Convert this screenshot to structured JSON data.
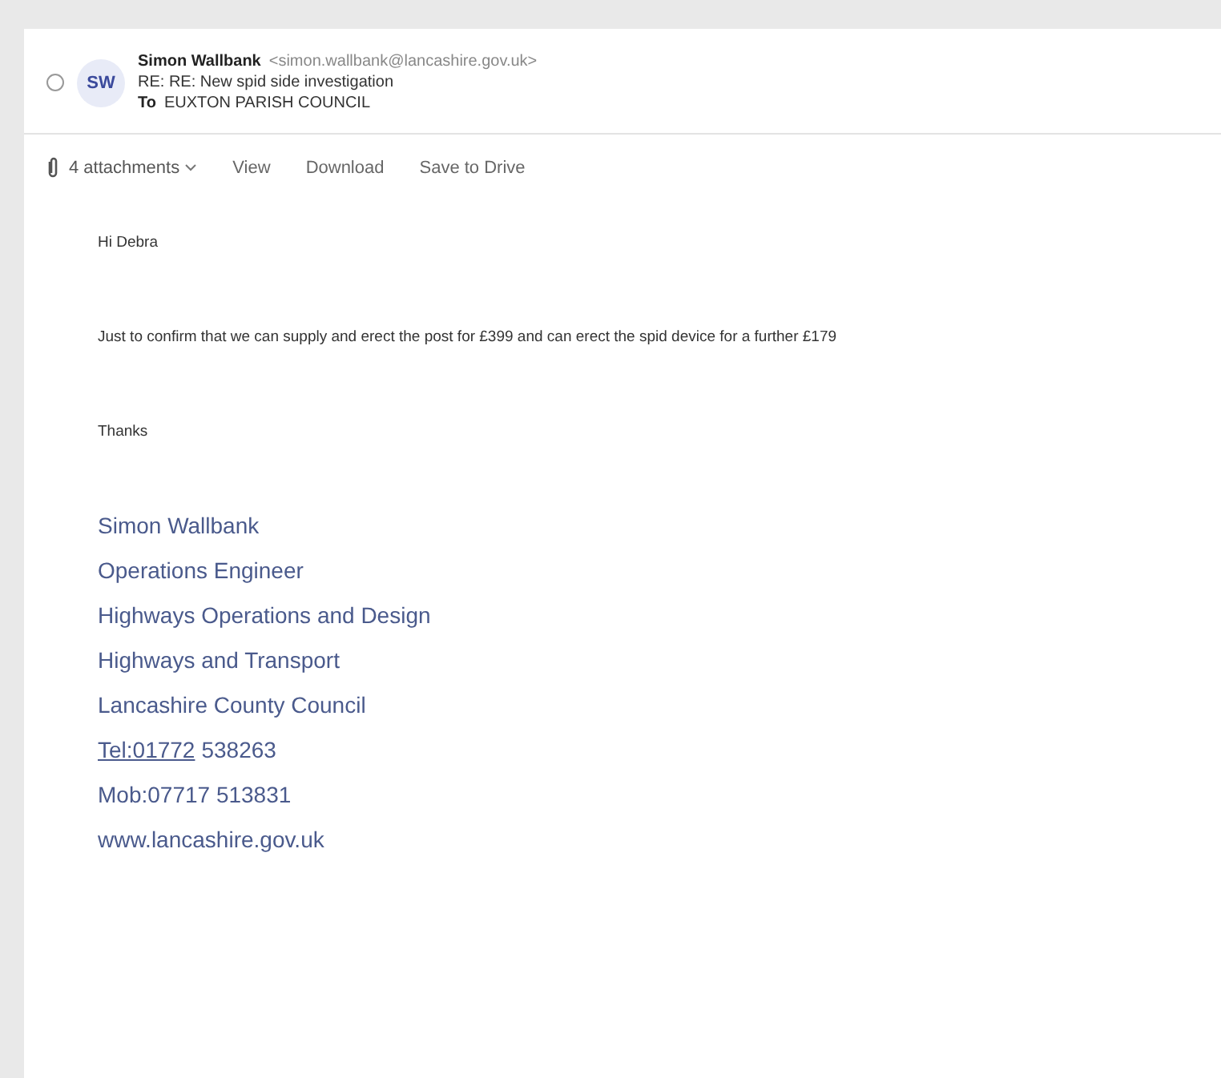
{
  "message": {
    "selected": false,
    "avatar": "SW",
    "sender": "Simon Wallbank",
    "address": "<simon.wallbank@lancashire.gov.uk>",
    "subject": "RE: RE: New spid side investigation",
    "to_label": "To",
    "to": "EUXTON PARISH COUNCIL"
  },
  "attachments": {
    "label": "4 attachments",
    "actions": [
      "View",
      "Download",
      "Save to Drive"
    ]
  },
  "body": [
    "Hi Debra",
    "Just to confirm that we can supply and erect the post for £399 and can erect the spid device for a further £179",
    "Thanks"
  ],
  "signature": [
    {
      "kind": "text",
      "text": "Simon Wallbank"
    },
    {
      "kind": "text",
      "text": "Operations Engineer"
    },
    {
      "kind": "text",
      "text": "Highways Operations and Design"
    },
    {
      "kind": "text",
      "text": "Highways and Transport"
    },
    {
      "kind": "text",
      "text": "Lancashire County Council"
    },
    {
      "kind": "phone",
      "link": "Tel:01772",
      "text": "538263"
    },
    {
      "kind": "text",
      "text": "Mob:07717 513831"
    },
    {
      "kind": "text",
      "text": "www.lancashire.gov.uk"
    }
  ]
}
